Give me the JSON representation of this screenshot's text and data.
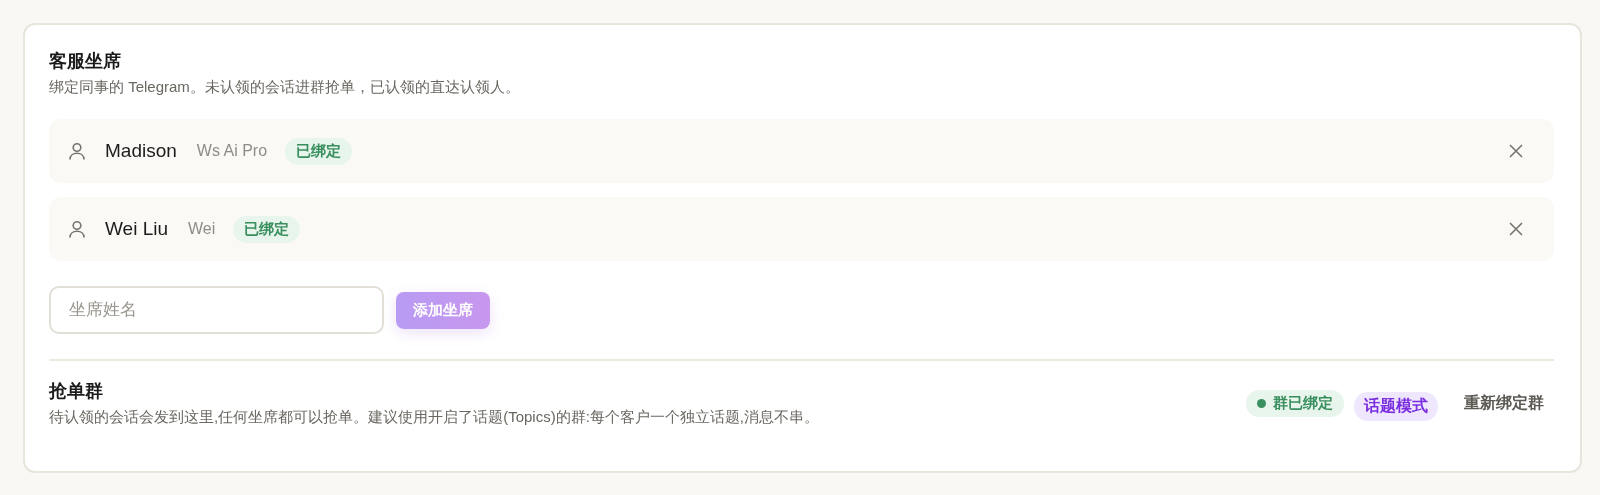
{
  "agents": {
    "title": "客服坐席",
    "description": "绑定同事的 Telegram。未认领的会话进群抢单，已认领的直达认领人。",
    "members": [
      {
        "name": "Madison",
        "username": "Ws Ai Pro",
        "status": "已绑定"
      },
      {
        "name": "Wei Liu",
        "username": "Wei",
        "status": "已绑定"
      }
    ],
    "name_field": {
      "placeholder": "坐席姓名"
    },
    "add_button": {
      "label": "添加坐席",
      "disabled": true
    }
  },
  "grab_group": {
    "title": "抢单群",
    "description": "待认领的会话会发到这里,任何坐席都可以抢单。建议使用开启了话题(Topics)的群:每个客户一个独立话题,消息不串。",
    "status": {
      "label": "群已绑定",
      "color": "#3a8f5e"
    },
    "mode": "话题模式",
    "rebind_button": "重新绑定群"
  }
}
